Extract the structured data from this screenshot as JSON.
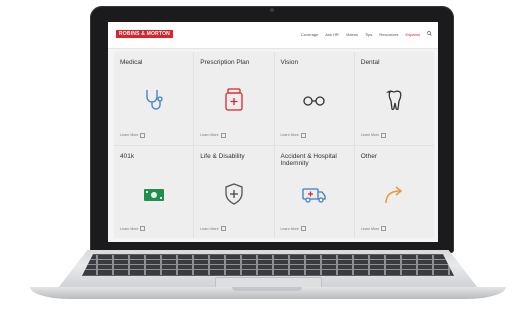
{
  "site": {
    "logo": "ROBINS & MORTON",
    "nav": [
      "Coverage",
      "Ask HR",
      "Videos",
      "Tips",
      "Resources",
      "Espanol"
    ],
    "active_nav_index": 5
  },
  "cards": [
    {
      "title": "Medical",
      "icon": "stethoscope-icon",
      "link": "Learn More"
    },
    {
      "title": "Prescription Plan",
      "icon": "pill-bottle-icon",
      "link": "Learn More"
    },
    {
      "title": "Vision",
      "icon": "glasses-icon",
      "link": "Learn More"
    },
    {
      "title": "Dental",
      "icon": "tooth-icon",
      "link": "Learn More"
    },
    {
      "title": "401k",
      "icon": "money-icon",
      "link": "Learn More"
    },
    {
      "title": "Life & Disability",
      "icon": "shield-cross-icon",
      "link": "Learn More"
    },
    {
      "title": "Accident & Hospital Indemnity",
      "icon": "ambulance-icon",
      "link": "Learn More"
    },
    {
      "title": "Other",
      "icon": "arrow-icon",
      "link": "Learn More"
    }
  ],
  "colors": {
    "brand": "#d7262e",
    "medical": "#3a7fc4",
    "prescription": "#d7262e",
    "vision": "#333333",
    "dental": "#333333",
    "money": "#1f8f4e",
    "shield": "#555555",
    "ambulance": "#3a7fc4",
    "other": "#e39b3a"
  }
}
